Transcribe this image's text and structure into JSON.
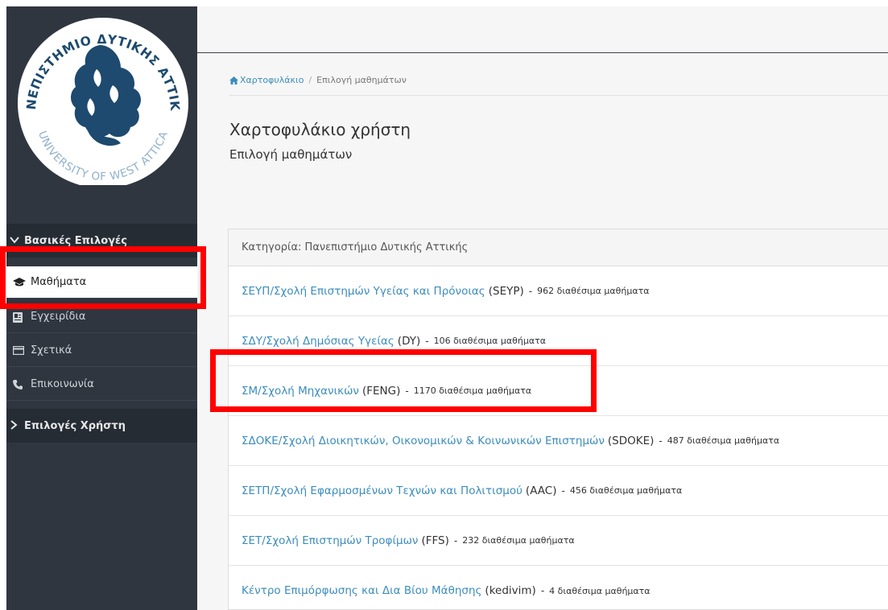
{
  "sidebar": {
    "logo": {
      "top_text": "ΠΑΝΕΠΙΣΤΗΜΙΟ ΔΥΤΙΚΗΣ ΑΤΤΙΚΗΣ",
      "bottom_text": "UNIVERSITY OF WEST ATTICA"
    },
    "basic_header": "Βασικές Επιλογές",
    "user_header": "Επιλογές Χρήστη",
    "items": [
      {
        "label": "Μαθήματα",
        "icon": "graduation-cap-icon"
      },
      {
        "label": "Εγχειρίδια",
        "icon": "book-icon"
      },
      {
        "label": "Σχετικά",
        "icon": "card-icon"
      },
      {
        "label": "Επικοινωνία",
        "icon": "phone-icon"
      }
    ]
  },
  "breadcrumb": {
    "home": "Χαρτοφυλάκιο",
    "separator": "/",
    "current": "Επιλογή μαθημάτων"
  },
  "header": {
    "title": "Χαρτοφυλάκιο χρήστη",
    "subtitle": "Επιλογή μαθημάτων"
  },
  "panel": {
    "heading": "Κατηγορία: Πανεπιστήμιο Δυτικής Αττικής",
    "dash": "-",
    "rows": [
      {
        "name": "ΣΕΥΠ/Σχολή Επιστημών Υγείας και Πρόνοιας",
        "code": "(SEYP)",
        "available": "962 διαθέσιμα μαθήματα"
      },
      {
        "name": "ΣΔΥ/Σχολή Δημόσιας Υγείας",
        "code": "(DY)",
        "available": "106 διαθέσιμα μαθήματα"
      },
      {
        "name": "ΣΜ/Σχολή Μηχανικών",
        "code": "(FENG)",
        "available": "1170 διαθέσιμα μαθήματα"
      },
      {
        "name": "ΣΔΟΚΕ/Σχολή Διοικητικών, Οικονομικών & Κοινωνικών Επιστημών",
        "code": "(SDOKE)",
        "available": "487 διαθέσιμα μαθήματα"
      },
      {
        "name": "ΣΕΤΠ/Σχολή Εφαρμοσμένων Τεχνών και Πολιτισμού",
        "code": "(AAC)",
        "available": "456 διαθέσιμα μαθήματα"
      },
      {
        "name": "ΣΕΤ/Σχολή Επιστημών Τροφίμων",
        "code": "(FFS)",
        "available": "232 διαθέσιμα μαθήματα"
      },
      {
        "name": "Κέντρο Επιμόρφωσης και Δια Βίου Μάθησης",
        "code": "(kedivim)",
        "available": "4 διαθέσιμα μαθήματα"
      }
    ]
  },
  "colors": {
    "sidebar": "#2f3640",
    "link": "#3c8dbc",
    "highlight": "#ff0000",
    "logo": "#1d4a6e"
  }
}
